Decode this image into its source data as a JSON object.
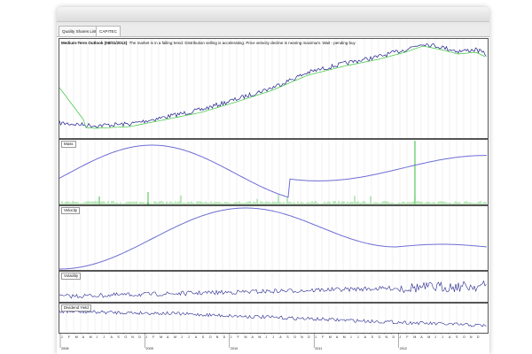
{
  "tabs": [
    {
      "label": "Quality Shares List"
    },
    {
      "label": "CAPITEC"
    }
  ],
  "outlook": {
    "heading": "Medium-Term Outlook (08/01/2013)",
    "text": ": The market is in a falling trend. Distribution selling is accelerating. Price velocity decline is nearing maximum. Wait - pending buy"
  },
  "panels": {
    "mass": {
      "label": "Mass"
    },
    "velocity": {
      "label": "Velocity"
    },
    "volatility": {
      "label": "Volatility"
    },
    "dividend": {
      "label": "Dividend Yield"
    }
  },
  "timeline": {
    "months": [
      "J",
      "F",
      "M",
      "A",
      "M",
      "J",
      "J",
      "A",
      "S",
      "O",
      "N",
      "D"
    ],
    "years": [
      "2008",
      "2009",
      "2010",
      "2011",
      "2012"
    ]
  },
  "colors": {
    "price": "#1d1f8a",
    "trend": "#3cc63c",
    "mass_curve": "#6d6dd6",
    "volume": "#2fb82f",
    "velocity_curve": "#6d6dd6",
    "volatility": "#25278f",
    "dividend": "#25278f",
    "grid": "#d4d4d4"
  }
}
